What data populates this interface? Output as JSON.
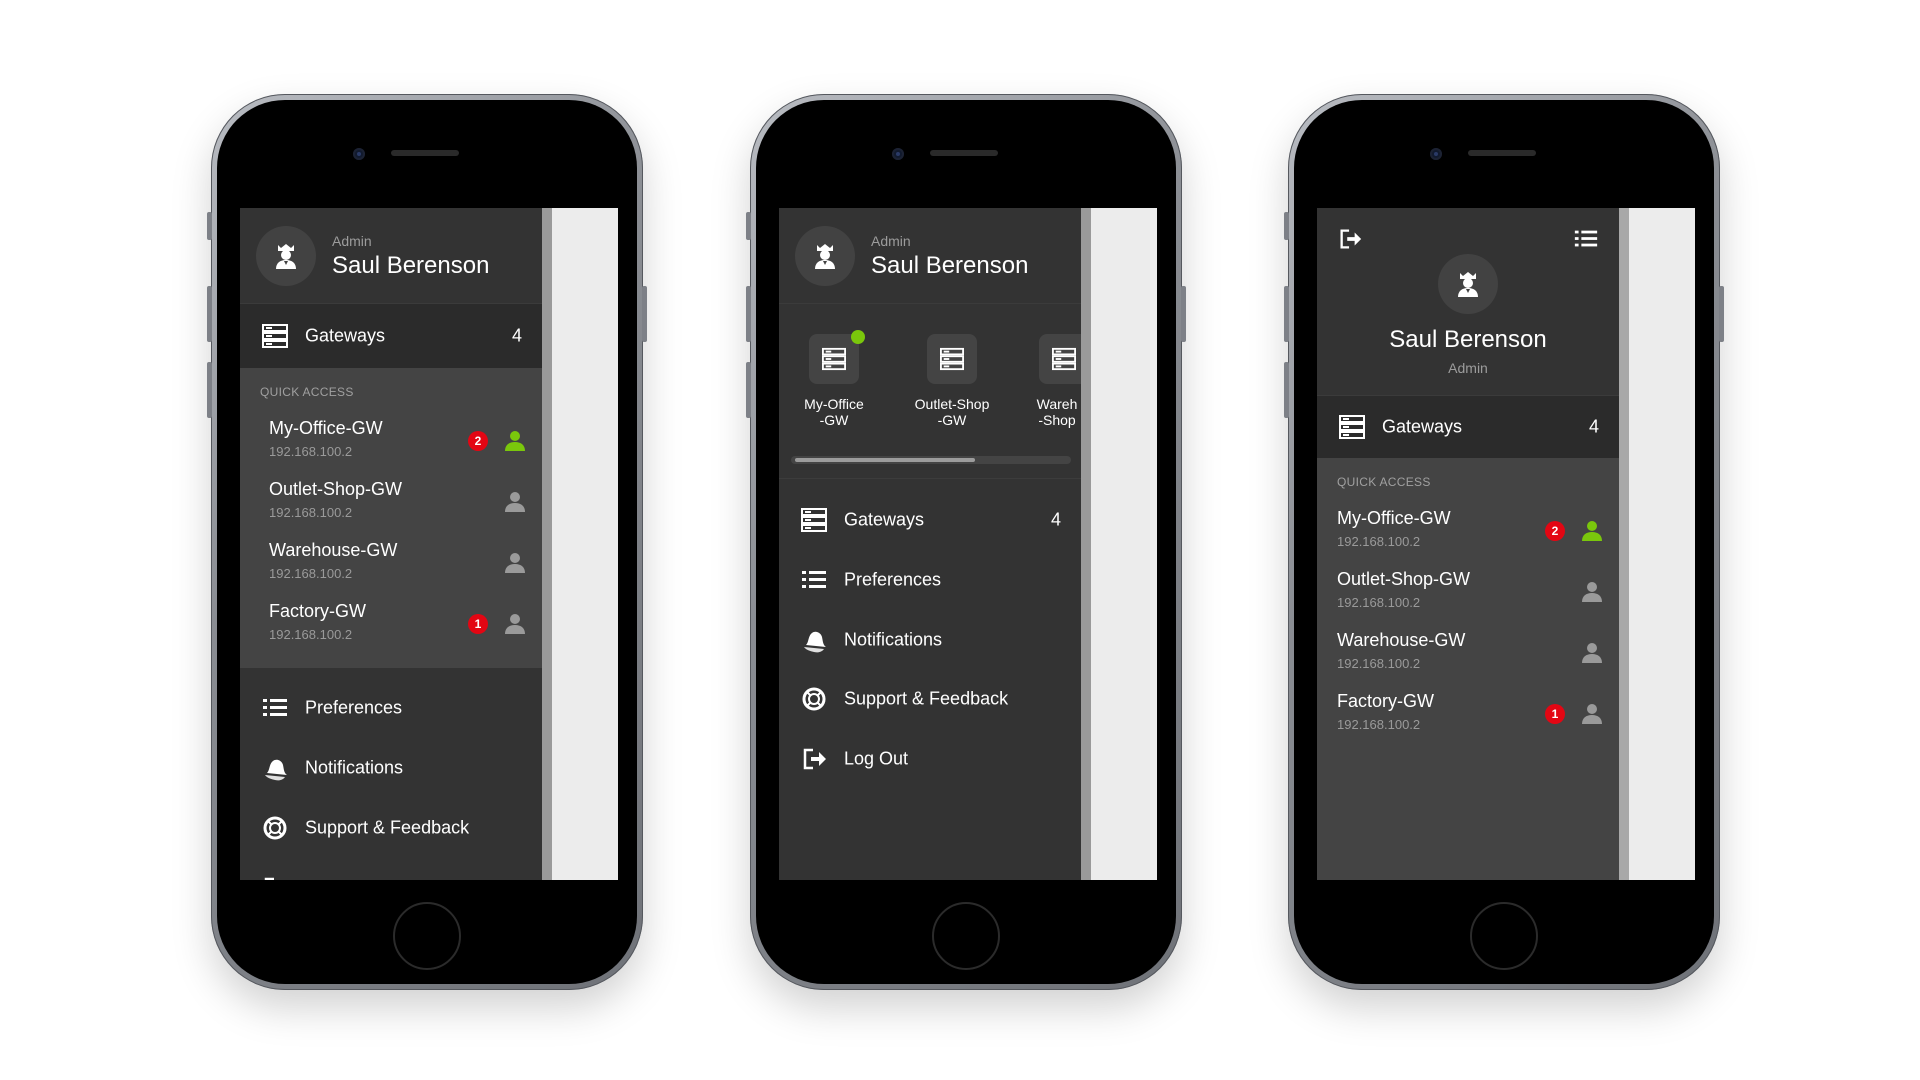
{
  "user": {
    "role": "Admin",
    "name": "Saul Berenson"
  },
  "menu": {
    "gateways_label": "Gateways",
    "gateways_count": "4",
    "quick_access_title": "QUICK ACCESS",
    "preferences": "Preferences",
    "notifications": "Notifications",
    "support": "Support & Feedback",
    "logout": "Log Out"
  },
  "quick_access": [
    {
      "name": "My-Office-GW",
      "ip": "192.168.100.2",
      "badge": "2",
      "user_active": true
    },
    {
      "name": "Outlet-Shop-GW",
      "ip": "192.168.100.2",
      "badge": "",
      "user_active": false
    },
    {
      "name": "Warehouse-GW",
      "ip": "192.168.100.2",
      "badge": "",
      "user_active": false
    },
    {
      "name": "Factory-GW",
      "ip": "192.168.100.2",
      "badge": "1",
      "user_active": false
    }
  ],
  "carousel": [
    {
      "label": "My-Office\n-GW",
      "online": true
    },
    {
      "label": "Outlet-Shop\n-GW",
      "online": false
    },
    {
      "label": "Wareh\n-Shop",
      "online": false
    }
  ],
  "colors": {
    "accent_green": "#7ac70c",
    "badge_red": "#e30613",
    "drawer_bg": "#333333"
  },
  "icons": [
    "admin-avatar-icon",
    "gateway-icon",
    "list-icon",
    "bell-icon",
    "lifebuoy-icon",
    "logout-icon",
    "user-icon"
  ]
}
